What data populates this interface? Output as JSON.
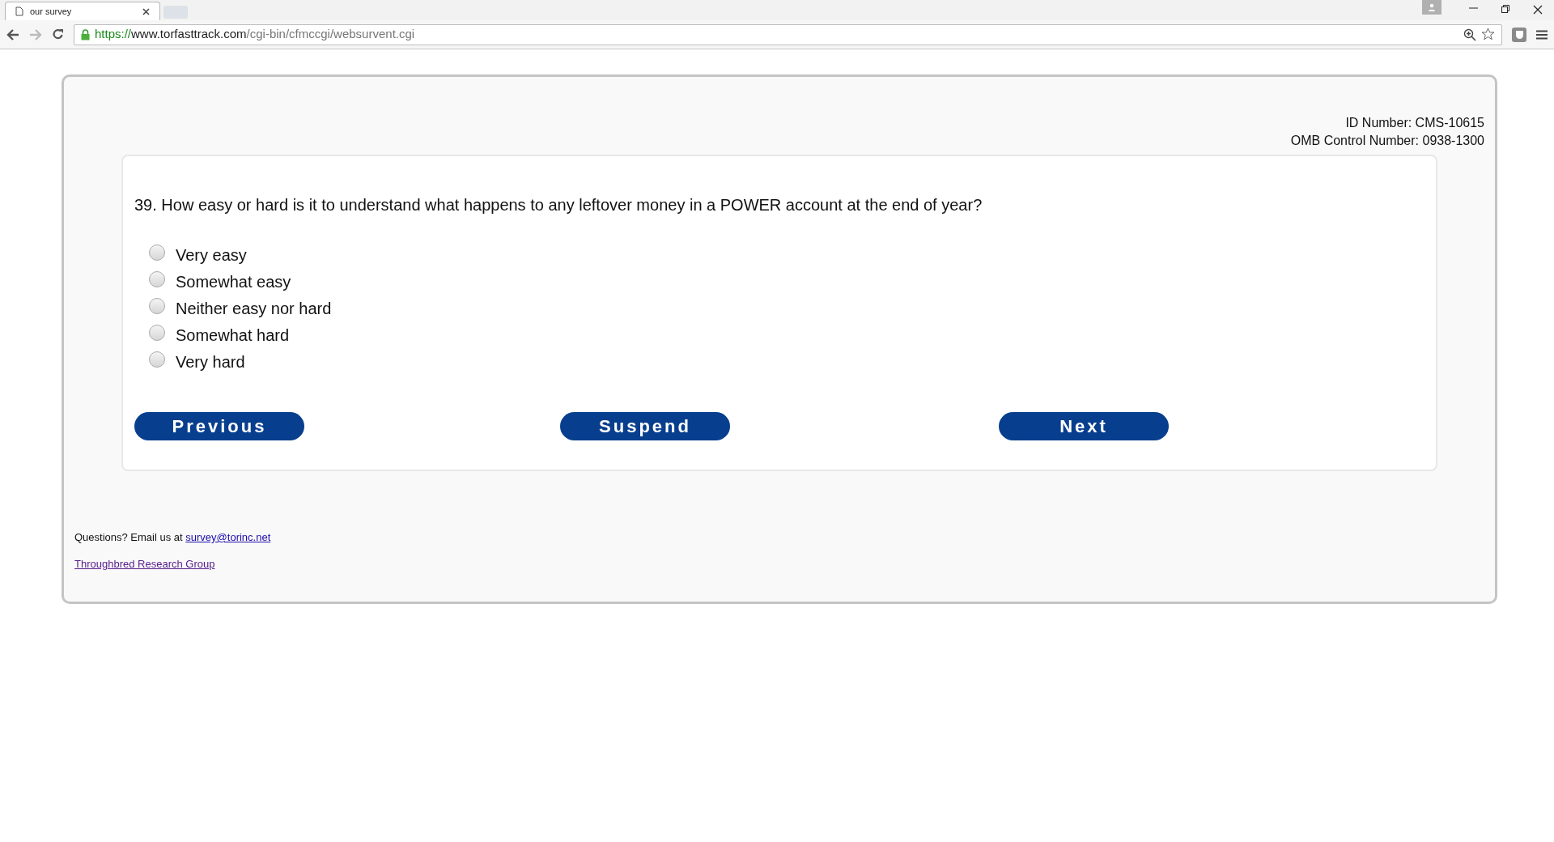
{
  "browser": {
    "tab_title": "our survey",
    "url_scheme": "https://",
    "url_host": "www.torfasttrack.com",
    "url_path": "/cgi-bin/cfmccgi/websurvent.cgi"
  },
  "ids": [
    "ID Number: CMS-10615",
    "OMB Control Number: 0938-1300"
  ],
  "question": "39. How easy or hard is it to understand what happens to any leftover money in a POWER account at the end of year?",
  "options": [
    {
      "label": "Very easy",
      "selected": false
    },
    {
      "label": "Somewhat easy",
      "selected": false
    },
    {
      "label": "Neither easy nor hard",
      "selected": false
    },
    {
      "label": "Somewhat hard",
      "selected": false
    },
    {
      "label": "Very hard",
      "selected": false
    }
  ],
  "buttons": [
    "Previous",
    "Suspend",
    "Next"
  ],
  "footer": {
    "question_text": "Questions? Email us at",
    "email": "survey@torinc.net",
    "org_link": "Throughbred Research Group"
  }
}
